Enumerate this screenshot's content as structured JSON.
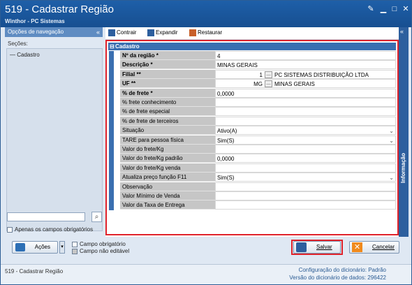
{
  "window": {
    "title": "519 - Cadastrar Região",
    "subtitle": "Winthor - PC Sistemas"
  },
  "nav": {
    "header": "Opções de navegação",
    "sections_label": "Seções:",
    "items": [
      "Cadastro"
    ],
    "only_required_label": "Apenas os campos obrigatórios",
    "actions_label": "Ações",
    "legend_required": "Campo obrigatório",
    "legend_not_editable": "Campo não editável"
  },
  "toolbar": {
    "collapse_label": "Contrair",
    "expand_label": "Expandir",
    "restore_label": "Restaurar"
  },
  "form": {
    "section_title": "Cadastro",
    "fields": [
      {
        "label": "Nº da região *",
        "value": "4",
        "bold": true
      },
      {
        "label": "Descrição *",
        "value": "MINAS GERAIS",
        "bold": true
      },
      {
        "label": "Filial **",
        "value": "1",
        "value2": "PC SISTEMAS DISTRIBUIÇÃO LTDA",
        "bold": true,
        "lookup": true
      },
      {
        "label": "UF **",
        "value": "MG",
        "value2": "MINAS GERAIS",
        "bold": true,
        "lookup": true
      },
      {
        "label": "% de frete *",
        "value": "0,0000",
        "bold": true
      },
      {
        "label": "% frete conhecimento",
        "value": ""
      },
      {
        "label": "% de frete especial",
        "value": ""
      },
      {
        "label": "% de frete de terceiros",
        "value": ""
      },
      {
        "label": "Situação",
        "value": "Ativo(A)",
        "dropdown": true
      },
      {
        "label": "TARE para pessoa física",
        "value": "Sim(S)",
        "dropdown": true
      },
      {
        "label": "Valor do frete/Kg",
        "value": ""
      },
      {
        "label": "Valor do frete/Kg padrão",
        "value": "0,0000"
      },
      {
        "label": "Valor do frete/Kg venda",
        "value": ""
      },
      {
        "label": "Atualiza preço função F11",
        "value": "Sim(S)",
        "dropdown": true
      },
      {
        "label": "Observação",
        "value": ""
      },
      {
        "label": "Valor Mínimo de Venda",
        "value": ""
      },
      {
        "label": "Valor da Taxa de Entrega",
        "value": ""
      }
    ]
  },
  "info_panel_label": "Informação",
  "buttons": {
    "save_label": "Salvar",
    "cancel_label": "Cancelar"
  },
  "status": {
    "left": "519 - Cadastrar Região",
    "dict_config": "Configuração do dicionário: Padrão",
    "dict_version": "Versão do dicionário de dados: 296422"
  },
  "colors": {
    "title_bar": "#1e5fa8",
    "highlight": "#e0232b",
    "section_header": "#3a6fb0"
  }
}
